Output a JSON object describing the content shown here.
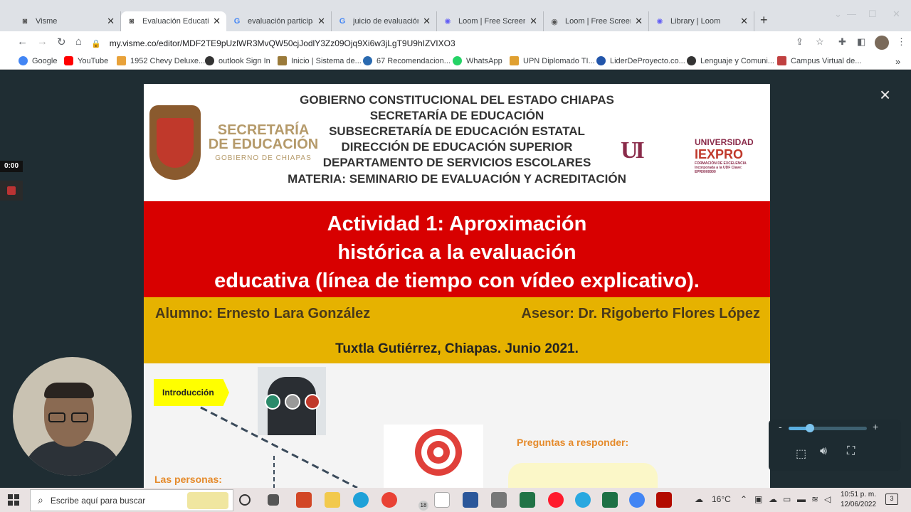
{
  "browser": {
    "tabs": [
      {
        "label": "Visme",
        "icon": "visme-icon"
      },
      {
        "label": "Evaluación Educativa",
        "icon": "visme-icon"
      },
      {
        "label": "evaluación participati",
        "icon": "google-icon"
      },
      {
        "label": "juicio de evaluación",
        "icon": "google-icon"
      },
      {
        "label": "Loom | Free Screen &",
        "icon": "loom-icon"
      },
      {
        "label": "Loom | Free Screen &",
        "icon": "globe-icon"
      },
      {
        "label": "Library | Loom",
        "icon": "loom-icon"
      }
    ],
    "new_tab": "+",
    "url": "my.visme.co/editor/MDF2TE9pUzlWR3MvQW50cjJodlY3Zz09Ojq9Xi6w3jLgT9U9hIZVIXO3",
    "bookmarks": [
      {
        "label": "Google",
        "color": "#4285f4"
      },
      {
        "label": "YouTube",
        "color": "#ff0000"
      },
      {
        "label": "1952 Chevy Deluxe...",
        "color": "#e8a23a"
      },
      {
        "label": "outlook Sign In",
        "color": "#333333"
      },
      {
        "label": "Inicio | Sistema de...",
        "color": "#9a7a3a"
      },
      {
        "label": "67 Recomendacion...",
        "color": "#2a6ab0"
      },
      {
        "label": "WhatsApp",
        "color": "#25d366"
      },
      {
        "label": "UPN Diplomado TI...",
        "color": "#e0a030"
      },
      {
        "label": "LiderDeProyecto.co...",
        "color": "#2255aa"
      },
      {
        "label": "Lenguaje y Comuni...",
        "color": "#333333"
      },
      {
        "label": "Campus Virtual de...",
        "color": "#c04040"
      }
    ],
    "more_bookmarks": "»"
  },
  "slide": {
    "header_lines": [
      "GOBIERNO CONSTITUCIONAL DEL ESTADO CHIAPAS",
      "SECRETARÍA DE EDUCACIÓN",
      "SUBSECRETARÍA DE EDUCACIÓN ESTATAL",
      "DIRECCIÓN DE EDUCACIÓN SUPERIOR",
      "DEPARTAMENTO DE SERVICIOS ESCOLARES",
      "MATERIA: SEMINARIO DE EVALUACIÓN Y ACREDITACIÓN"
    ],
    "sec_logo": {
      "line1": "SECRETARÍA",
      "line2": "DE EDUCACIÓN",
      "line3": "GOBIERNO DE CHIAPAS"
    },
    "uni_logo": {
      "mark": "UI",
      "line1": "UNIVERSIDAD",
      "line2": "IEXPRO",
      "tag1": "FORMACIÓN DE EXCELENCIA",
      "tag2": "Incorporada a la UDF Clave: EPR0000000"
    },
    "title_lines": [
      "Actividad 1: Aproximación",
      "histórica a la evaluación",
      "educativa (línea de tiempo con vídeo explicativo)."
    ],
    "alumno": "Alumno: Ernesto Lara González",
    "asesor": "Asesor: Dr. Rigoberto Flores López",
    "lugar_fecha": "Tuxtla Gutiérrez, Chiapas. Junio 2021.",
    "intro_label": "Introducción",
    "preguntas_label": "Preguntas a responder:",
    "personas_label": "Las personas:"
  },
  "recorder": {
    "timer": "0:00",
    "close": "×",
    "volume_minus": "-",
    "volume_plus": "+",
    "volume_level": 0.27
  },
  "taskbar": {
    "search_placeholder": "Escribe aquí para buscar",
    "chrome_badge": "18",
    "temperature": "16°C",
    "time": "10:51 p. m.",
    "date": "12/06/2022",
    "notifications": "3"
  }
}
